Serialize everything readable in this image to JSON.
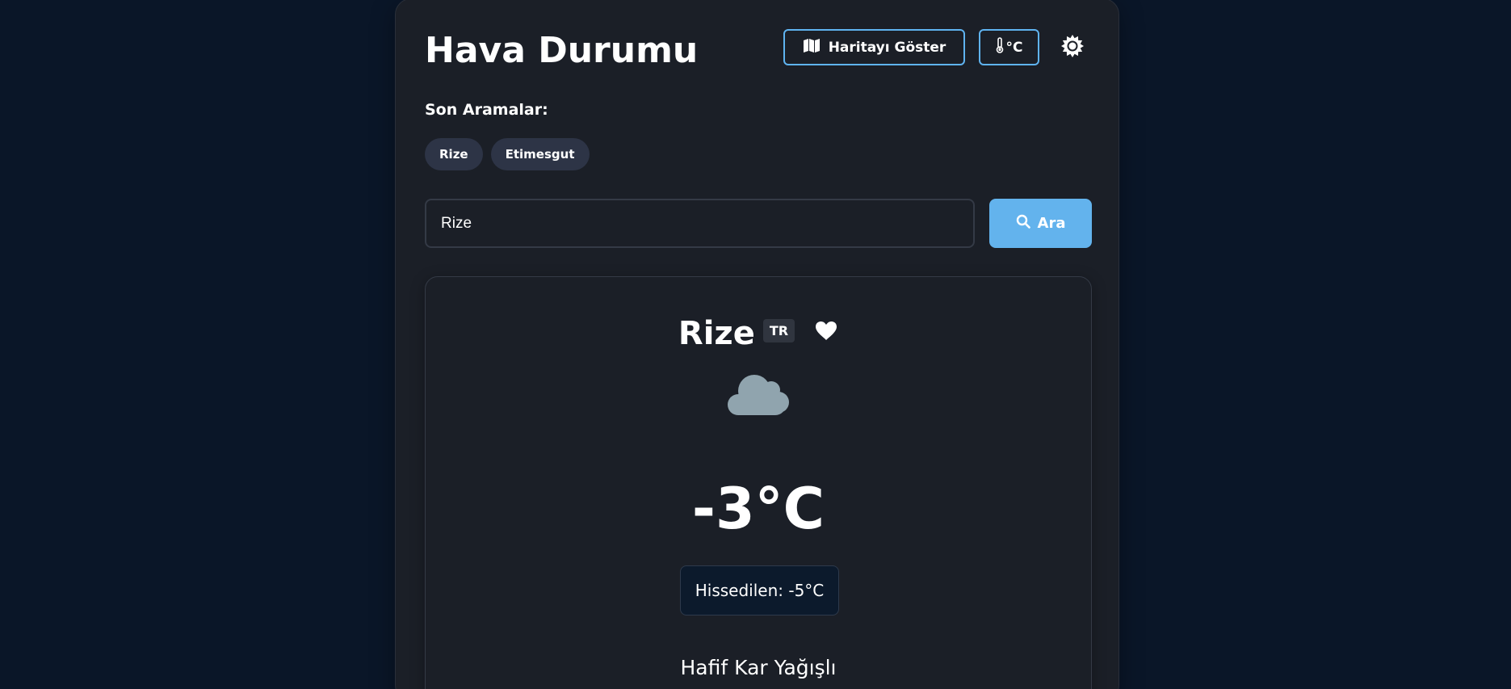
{
  "header": {
    "title": "Hava Durumu",
    "map_button_label": "Haritayı Göster",
    "unit_button_label": "°C"
  },
  "recent": {
    "label": "Son Aramalar:",
    "items": [
      "Rize",
      "Etimesgut"
    ]
  },
  "search": {
    "value": "Rize",
    "button_label": "Ara"
  },
  "weather": {
    "city": "Rize",
    "country": "TR",
    "temperature": "-3°C",
    "feels_like": "Hissedilen: -5°C",
    "condition": "Hafif Kar Yağışlı",
    "icon": "cloud-icon"
  },
  "colors": {
    "background": "#0a1628",
    "card": "#1b1f27",
    "accent": "#63b3ed",
    "chip": "#2d3446",
    "cloud": "#90a4ae"
  }
}
